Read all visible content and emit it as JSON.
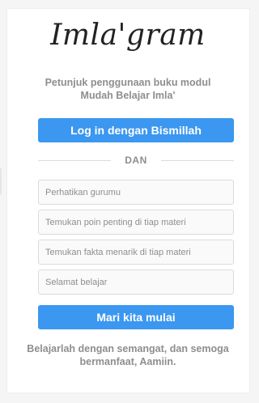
{
  "logo": {
    "text": "Imla'gram"
  },
  "subtitle": {
    "line1": "Petunjuk penggunaan buku modul",
    "line2": "Mudah Belajar Imla'"
  },
  "login_button": {
    "label": "Log in dengan Bismillah"
  },
  "divider": {
    "label": "DAN"
  },
  "fields": [
    {
      "placeholder": "Perhatikan gurumu"
    },
    {
      "placeholder": "Temukan poin penting di tiap materi"
    },
    {
      "placeholder": "Temukan fakta menarik di tiap materi"
    },
    {
      "placeholder": "Selamat belajar"
    }
  ],
  "start_button": {
    "label": "Mari kita mulai"
  },
  "footer": {
    "line1": "Belajarlah dengan semangat, dan semoga",
    "line2": "bermanfaat, Aamiin."
  },
  "colors": {
    "accent": "#3b97f0",
    "muted_text": "#8e8e8e",
    "border": "#dbdbdb"
  }
}
